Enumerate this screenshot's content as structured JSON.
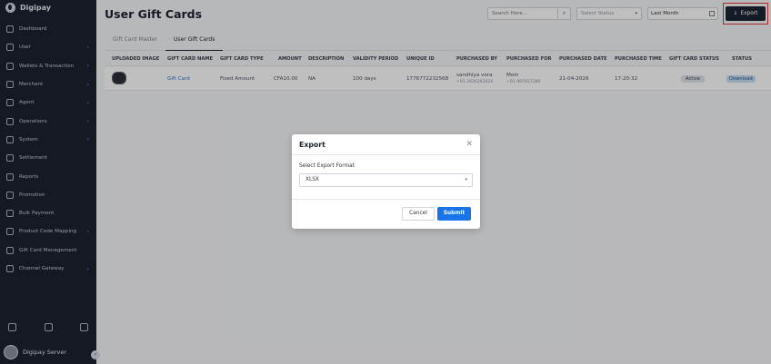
{
  "brand": {
    "name": "Digipay"
  },
  "sidebar": {
    "items": [
      {
        "label": "Dashboard",
        "icon": "dashboard-icon",
        "has_children": false
      },
      {
        "label": "User",
        "icon": "user-icon",
        "has_children": true
      },
      {
        "label": "Wallets & Transaction",
        "icon": "wallet-icon",
        "has_children": true
      },
      {
        "label": "Merchant",
        "icon": "merchant-icon",
        "has_children": true
      },
      {
        "label": "Agent",
        "icon": "agent-icon",
        "has_children": true
      },
      {
        "label": "Operations",
        "icon": "operations-icon",
        "has_children": true
      },
      {
        "label": "System",
        "icon": "monitor-icon",
        "has_children": true
      },
      {
        "label": "Settlement",
        "icon": "settlement-icon",
        "has_children": false
      },
      {
        "label": "Reports",
        "icon": "reports-icon",
        "has_children": false
      },
      {
        "label": "Promotion",
        "icon": "promotion-icon",
        "has_children": false
      },
      {
        "label": "Bulk Payment",
        "icon": "bulk-payment-icon",
        "has_children": false
      },
      {
        "label": "Product Code Mapping",
        "icon": "product-code-icon",
        "has_children": true
      },
      {
        "label": "Gift Card Management",
        "icon": "gift-card-icon",
        "has_children": false
      },
      {
        "label": "Channel Gateway",
        "icon": "channel-gateway-icon",
        "has_children": true
      }
    ],
    "footer_icons": [
      "hierarchy-icon",
      "bell-icon",
      "gear-icon"
    ],
    "user": {
      "name": "Digipay Server"
    }
  },
  "header": {
    "title": "User Gift Cards",
    "search_placeholder": "Search Here...",
    "status_placeholder": "Select Status",
    "date_range": "Last Month",
    "export_label": "Export"
  },
  "tabs": [
    {
      "label": "Gift Card Master",
      "active": false
    },
    {
      "label": "User Gift Cards",
      "active": true
    }
  ],
  "table": {
    "columns": [
      "UPLOADED IMAGE",
      "GIFT CARD NAME",
      "GIFT CARD TYPE",
      "AMOUNT",
      "DESCRIPTION",
      "VALIDITY PERIOD",
      "UNIQUE ID",
      "PURCHASED BY",
      "PURCHASED FOR",
      "PURCHASED DATE",
      "PURCHASED TIME",
      "GIFT CARD STATUS",
      "STATUS"
    ],
    "rows": [
      {
        "name": "Gift Card",
        "type": "Fixed Amount",
        "amount": "CFA10.00",
        "description": "NA",
        "validity": "100 days",
        "unique_id": "1776772232568",
        "purchased_by": {
          "name": "sandhiya vora",
          "phone": "+91 2626262626"
        },
        "purchased_for": {
          "name": "Moin",
          "phone": "+91 987927289"
        },
        "date": "21-04-2026",
        "time": "17:20:32",
        "gift_card_status": "Active",
        "status": "Download"
      }
    ]
  },
  "modal": {
    "title": "Export",
    "field_label": "Select Export Format",
    "selected_format": "XLSX",
    "cancel_label": "Cancel",
    "submit_label": "Submit"
  },
  "colors": {
    "sidebar_bg": "#1b2230",
    "primary_button": "#1a73e8",
    "highlight": "#e53935"
  }
}
